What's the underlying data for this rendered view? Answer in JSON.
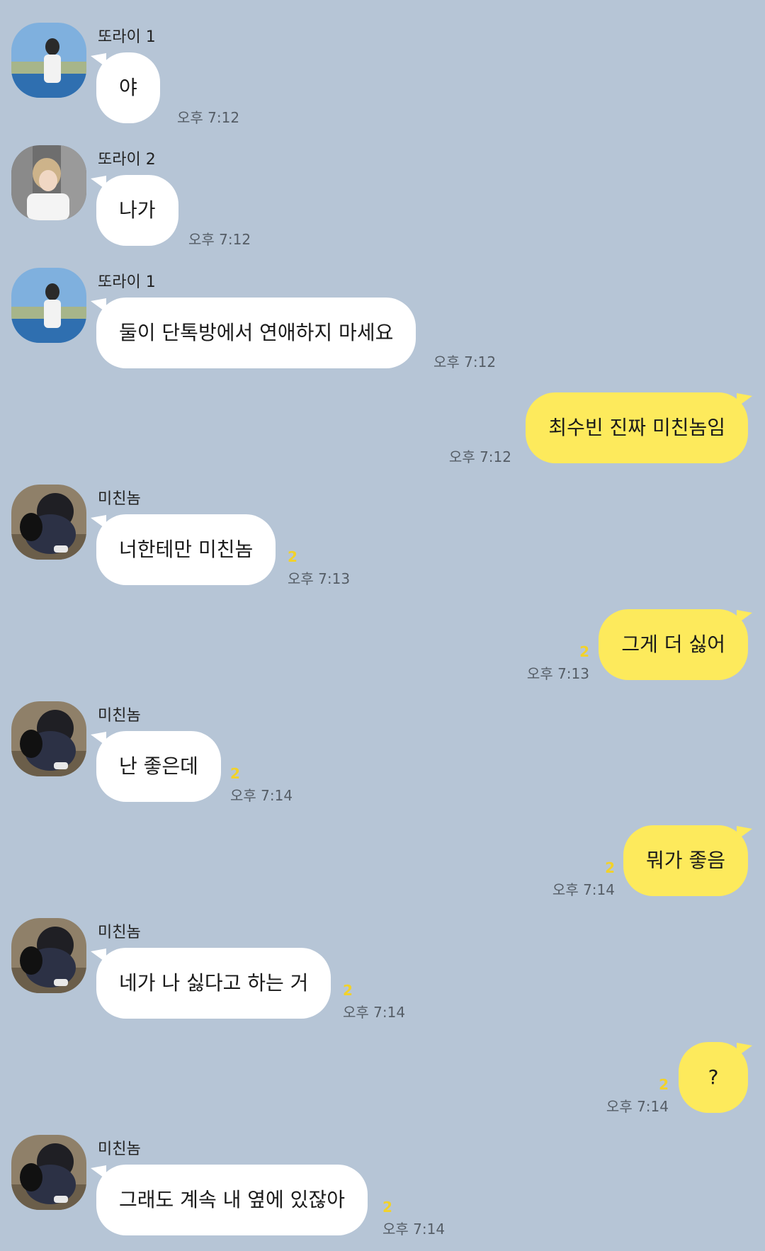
{
  "chat": {
    "messages": [
      {
        "direction": "in",
        "sender": "또라이 1",
        "avatar": "avatar-1",
        "text": "야",
        "time": "오후 7:12",
        "unread": ""
      },
      {
        "direction": "in",
        "sender": "또라이 2",
        "avatar": "avatar-2",
        "text": "나가",
        "time": "오후 7:12",
        "unread": ""
      },
      {
        "direction": "in",
        "sender": "또라이 1",
        "avatar": "avatar-1",
        "text": "둘이 단톡방에서 연애하지 마세요",
        "time": "오후 7:12",
        "unread": ""
      },
      {
        "direction": "out",
        "sender": "",
        "avatar": "",
        "text": "최수빈 진짜 미친놈임",
        "time": "오후 7:12",
        "unread": ""
      },
      {
        "direction": "in",
        "sender": "미친놈",
        "avatar": "avatar-3",
        "text": "너한테만 미친놈",
        "time": "오후 7:13",
        "unread": "2"
      },
      {
        "direction": "out",
        "sender": "",
        "avatar": "",
        "text": "그게 더 싫어",
        "time": "오후 7:13",
        "unread": "2"
      },
      {
        "direction": "in",
        "sender": "미친놈",
        "avatar": "avatar-3",
        "text": "난 좋은데",
        "time": "오후 7:14",
        "unread": "2"
      },
      {
        "direction": "out",
        "sender": "",
        "avatar": "",
        "text": "뭐가 좋음",
        "time": "오후 7:14",
        "unread": "2"
      },
      {
        "direction": "in",
        "sender": "미친놈",
        "avatar": "avatar-3",
        "text": "네가 나 싫다고 하는 거",
        "time": "오후 7:14",
        "unread": "2"
      },
      {
        "direction": "out",
        "sender": "",
        "avatar": "",
        "text": "?",
        "time": "오후 7:14",
        "unread": "2"
      },
      {
        "direction": "in",
        "sender": "미친놈",
        "avatar": "avatar-3",
        "text": "그래도 계속 내 옆에 있잖아",
        "time": "오후 7:14",
        "unread": "2"
      }
    ]
  },
  "colors": {
    "background": "#b6c5d6",
    "incoming_bubble": "#ffffff",
    "outgoing_bubble": "#fdea5c",
    "unread_count": "#f2d22a",
    "timestamp": "#555d66"
  }
}
